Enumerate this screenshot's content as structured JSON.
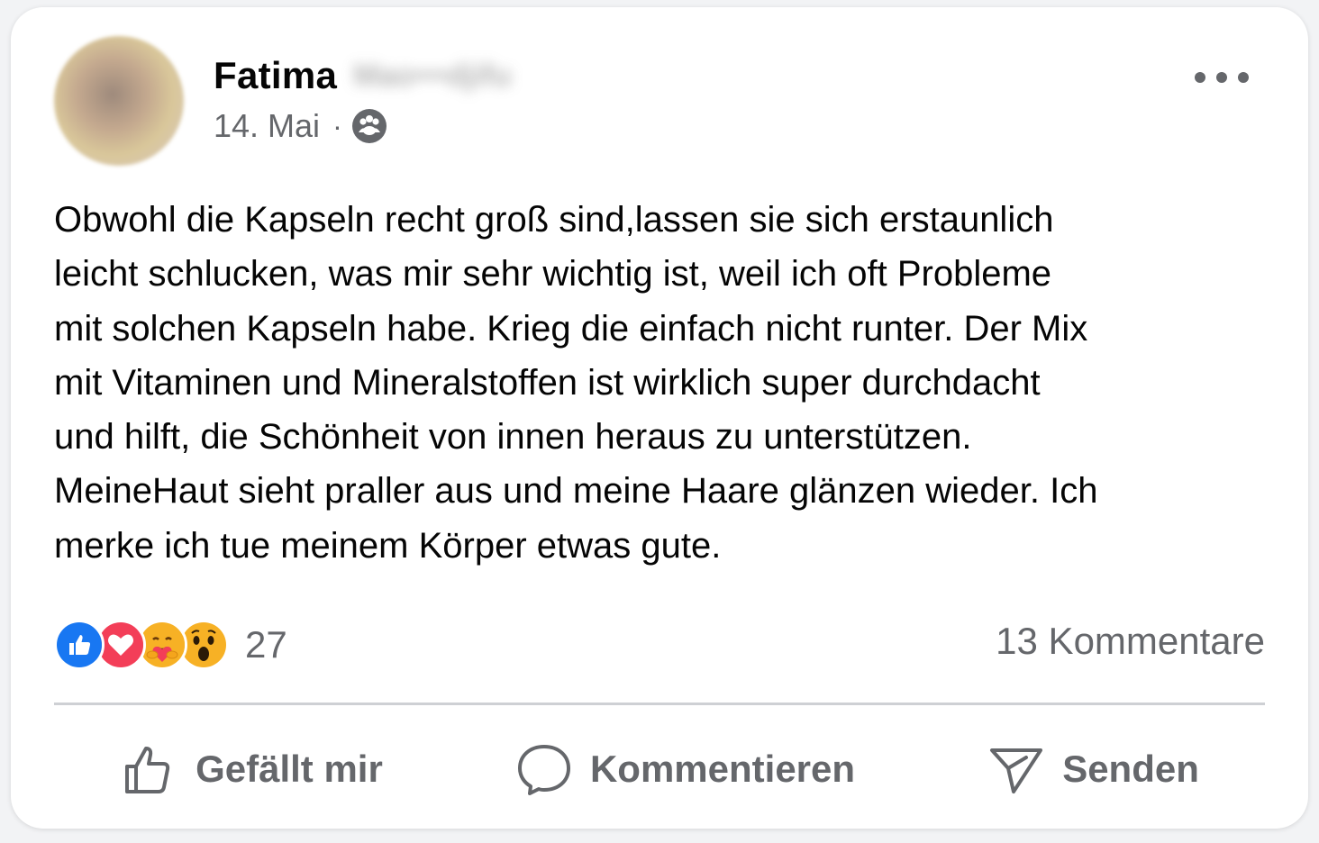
{
  "post": {
    "author_first": "Fatima",
    "author_last_blurred": "Mao•••djifu",
    "date": "14. Mai",
    "separator": "·",
    "audience_icon": "friends-icon",
    "text": "Obwohl die Kapseln recht groß sind,lassen sie sich erstaunlich\nleicht schlucken, was mir sehr wichtig ist, weil ich oft Probleme\nmit solchen Kapseln habe. Krieg die einfach nicht runter. Der Mix\nmit Vitaminen und Mineralstoffen ist wirklich super durchdacht\nund hilft, die Schönheit von innen heraus zu unterstützen.\nMeineHaut sieht praller aus und meine Haare glänzen wieder. Ich\nmerke ich tue meinem Körper etwas gute."
  },
  "stats": {
    "reactions": [
      "like-icon",
      "love-icon",
      "care-icon",
      "wow-icon"
    ],
    "reaction_count": "27",
    "comment_count": "13 Kommentare"
  },
  "actions": {
    "like_label": "Gefällt mir",
    "comment_label": "Kommentieren",
    "send_label": "Senden"
  },
  "colors": {
    "like_blue": "#1877f2",
    "love_red": "#f33e58",
    "emoji_yellow": "#f7b125",
    "text_secondary": "#65676b"
  }
}
